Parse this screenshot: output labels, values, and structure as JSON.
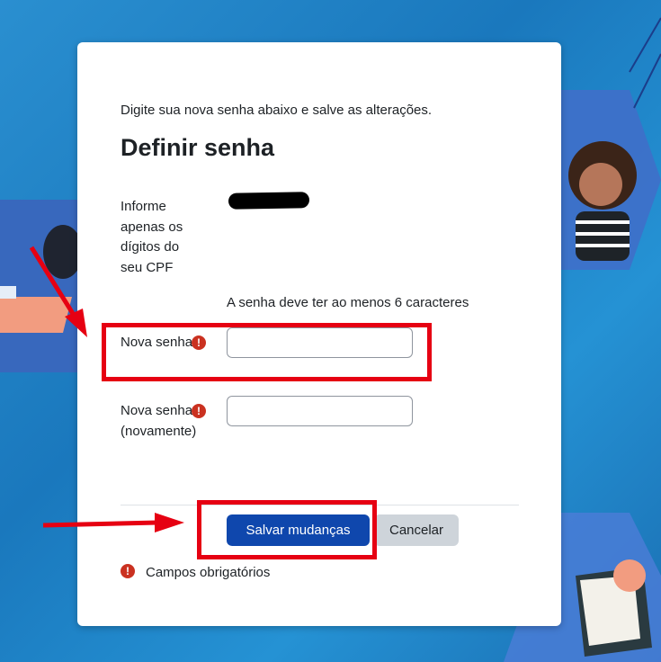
{
  "form": {
    "intro_text": "Digite sua nova senha abaixo e salve as alterações.",
    "title": "Definir senha",
    "cpf_label": "Informe apenas os dígitos do seu CPF",
    "password_hint": "A senha deve ter ao menos 6 caracteres",
    "new_password_label": "Nova senha",
    "new_password_value": "",
    "confirm_password_label": "Nova senha (novamente)",
    "confirm_password_value": "",
    "required_icon": "exclamation-circle-icon",
    "save_label": "Salvar mudanças",
    "cancel_label": "Cancelar",
    "required_fields_note": "Campos obrigatórios"
  },
  "colors": {
    "primary": "#0f47ad",
    "required": "#ca3120",
    "annotation": "#e60012"
  }
}
